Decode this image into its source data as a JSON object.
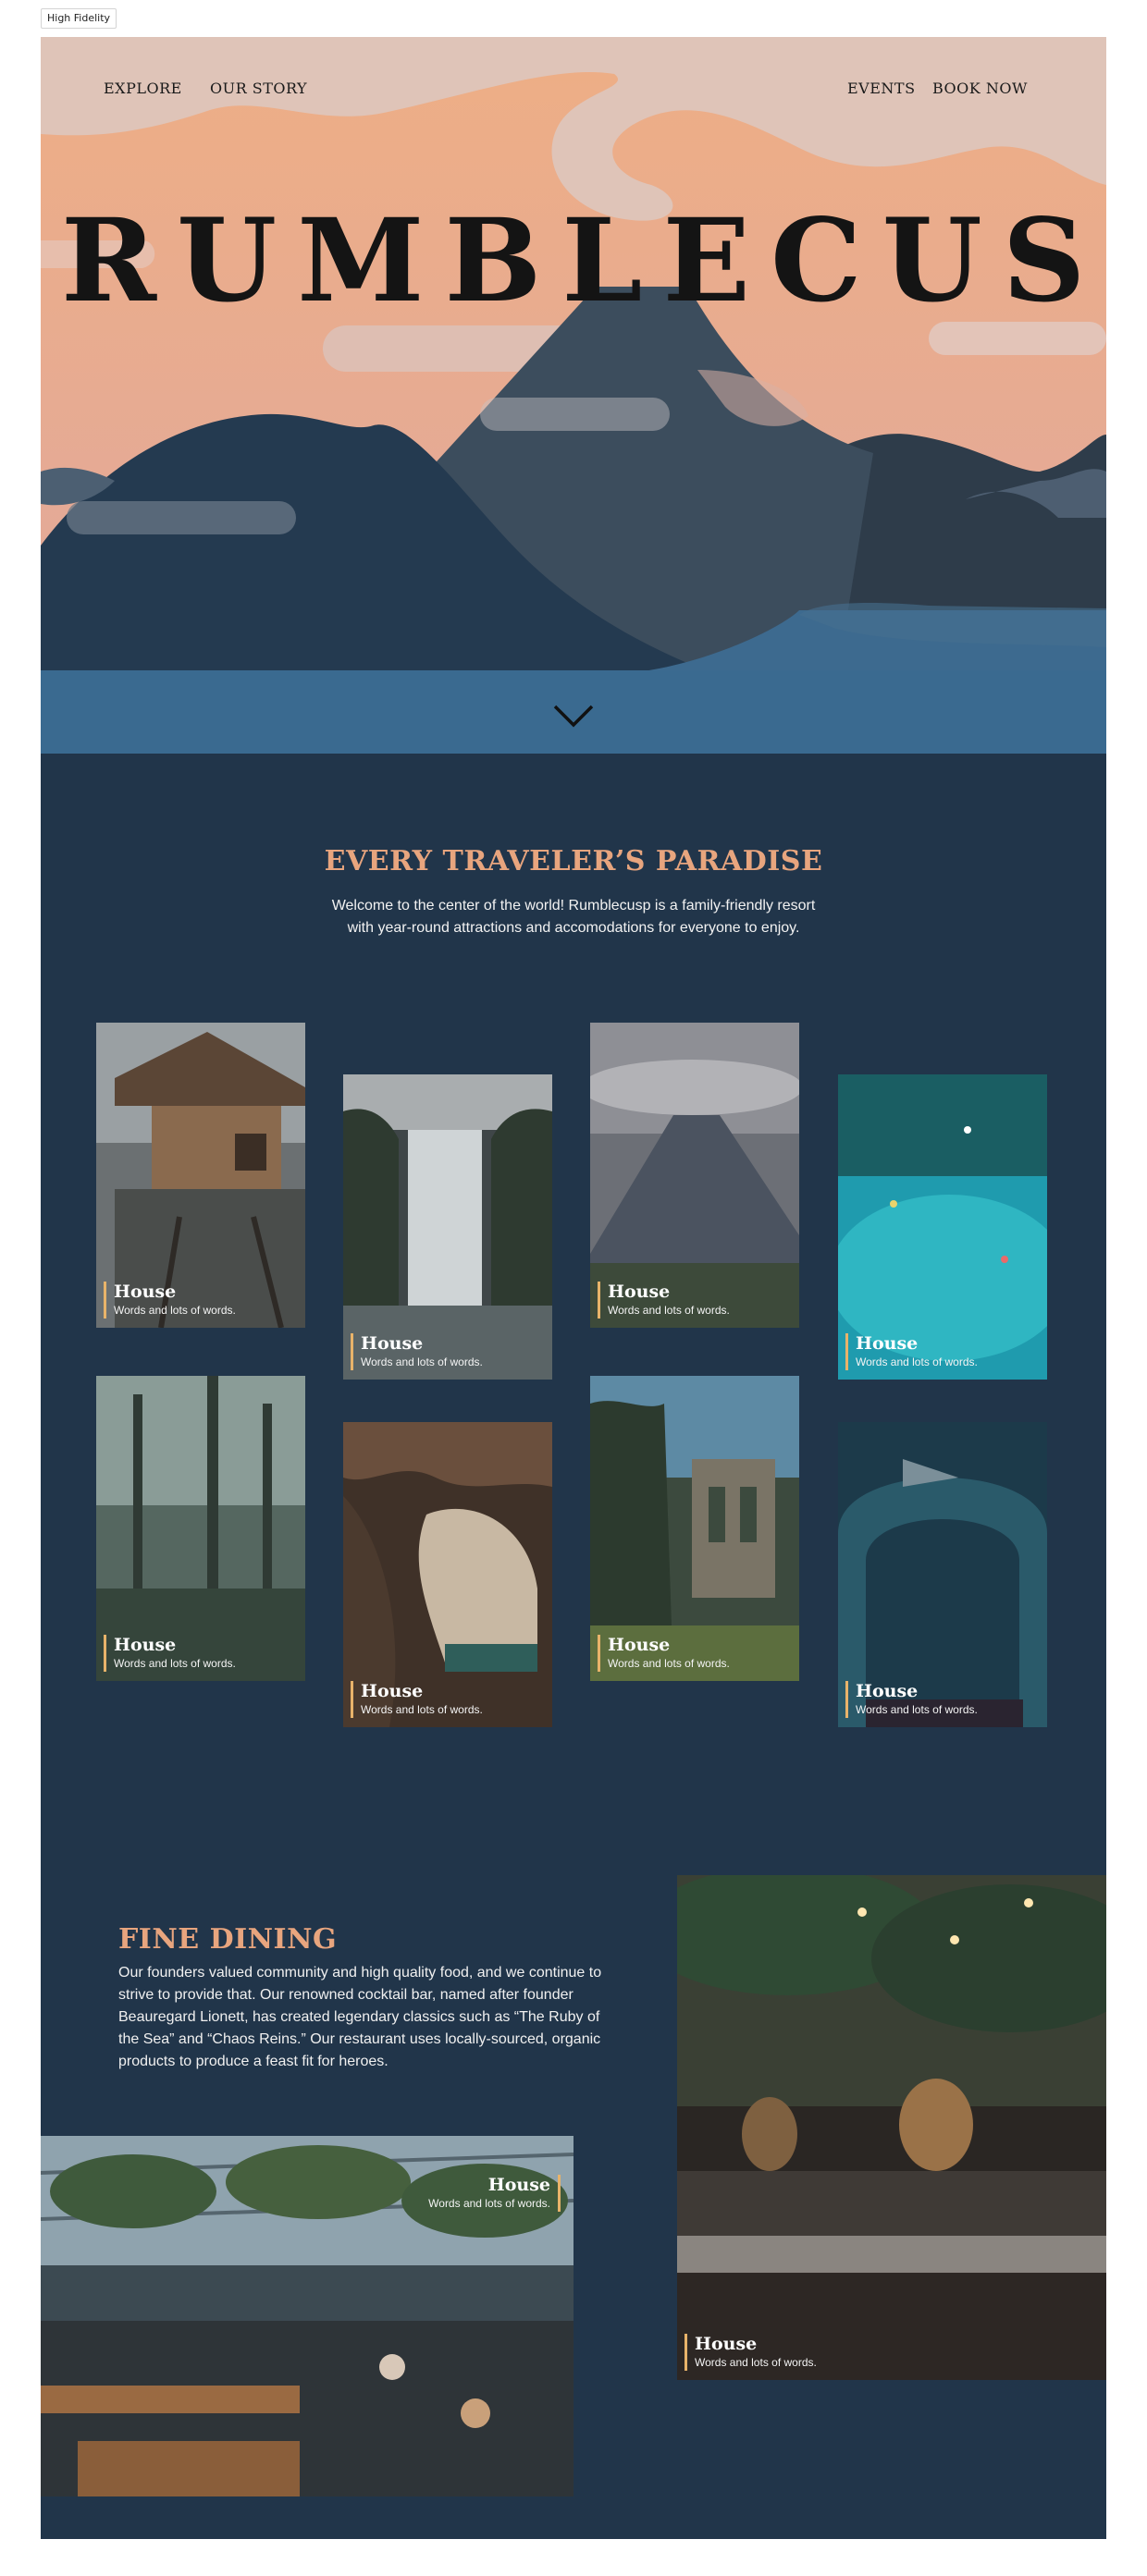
{
  "frame_label": "High Fidelity",
  "nav": {
    "left": [
      "EXPLORE",
      "OUR STORY"
    ],
    "right": [
      "EVENTS",
      "BOOK NOW"
    ]
  },
  "hero": {
    "title": "RUMBLECUSP",
    "scroll_icon": "chevron-down-icon"
  },
  "intro": {
    "title": "EVERY TRAVELER’S PARADISE",
    "text": "Welcome to the center of the world! Rumblecusp is a family-friendly resort with year-round attractions and accomodations for everyone to enjoy."
  },
  "cards": [
    {
      "title": "House",
      "text": "Words and lots of words.",
      "scene": "treehouse"
    },
    {
      "title": "House",
      "text": "Words and lots of words.",
      "scene": "waterfall"
    },
    {
      "title": "House",
      "text": "Words and lots of words.",
      "scene": "volcano"
    },
    {
      "title": "House",
      "text": "Words and lots of words.",
      "scene": "lagoon"
    },
    {
      "title": "House",
      "text": "Words and lots of words.",
      "scene": "forest"
    },
    {
      "title": "House",
      "text": "Words and lots of words.",
      "scene": "cave"
    },
    {
      "title": "House",
      "text": "Words and lots of words.",
      "scene": "ruins"
    },
    {
      "title": "House",
      "text": "Words and lots of words.",
      "scene": "aquarium"
    }
  ],
  "dining": {
    "title": "FINE DINING",
    "text": "Our founders valued community and high quality food, and we continue to strive to provide that. Our renowned cocktail bar, named after founder Beauregard Lionett, has created legendary classics such as “The Ruby of the Sea” and “Chaos Reins.” Our restaurant uses locally-sourced, organic products to produce a feast fit for heroes.",
    "photos": [
      {
        "title": "House",
        "text": "Words and lots of words.",
        "scene": "bar"
      },
      {
        "title": "House",
        "text": "Words and lots of words.",
        "scene": "greenhouse-restaurant"
      }
    ]
  },
  "colors": {
    "page_bg": "#21354a",
    "accent": "#e8a57e",
    "caption_bar": "#e8b36a",
    "sky": "#e7b19a",
    "water": "#3d6a8f"
  }
}
